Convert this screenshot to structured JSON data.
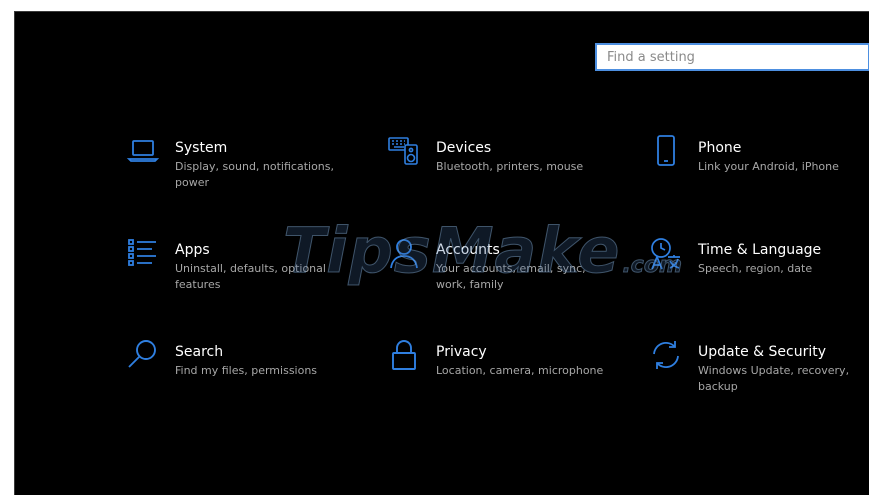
{
  "search": {
    "placeholder": "Find a setting"
  },
  "accent_color": "#2f7fe0",
  "tiles": [
    {
      "title": "System",
      "desc": "Display, sound, notifications, power",
      "icon": "laptop-icon"
    },
    {
      "title": "Devices",
      "desc": "Bluetooth, printers, mouse",
      "icon": "keyboard-speaker-icon"
    },
    {
      "title": "Phone",
      "desc": "Link your Android, iPhone",
      "icon": "phone-icon"
    },
    {
      "title": "Apps",
      "desc": "Uninstall, defaults, optional features",
      "icon": "apps-list-icon"
    },
    {
      "title": "Accounts",
      "desc": "Your accounts, email, sync, work, family",
      "icon": "person-icon"
    },
    {
      "title": "Time & Language",
      "desc": "Speech, region, date",
      "icon": "time-language-icon"
    },
    {
      "title": "Search",
      "desc": "Find my files, permissions",
      "icon": "magnifier-icon"
    },
    {
      "title": "Privacy",
      "desc": "Location, camera, microphone",
      "icon": "lock-icon"
    },
    {
      "title": "Update & Security",
      "desc": "Windows Update, recovery, backup",
      "icon": "refresh-icon"
    }
  ],
  "watermark": {
    "main": "TipsMake",
    "sub": ".com"
  }
}
